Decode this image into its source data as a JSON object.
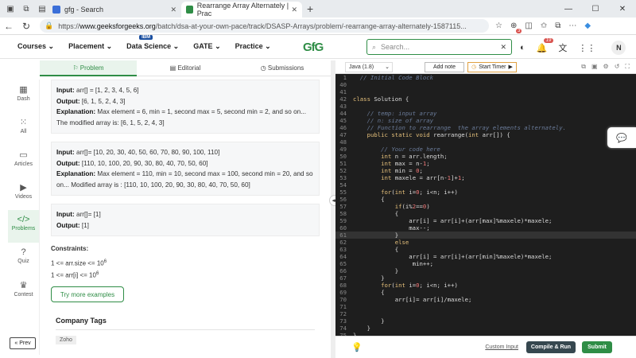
{
  "browser": {
    "tabs": [
      {
        "title": "gfg - Search"
      },
      {
        "title": "Rearrange Array Alternately | Prac"
      }
    ],
    "url_prefix": "https://",
    "url_host": "www.geeksforgeeks.org",
    "url_path": "/batch/dsa-at-your-own-pace/track/DSASP-Arrays/problem/-rearrange-array-alternately-1587115...",
    "ext_badge": "3"
  },
  "header": {
    "nav": [
      "Courses",
      "Placement",
      "Data Science",
      "GATE",
      "Practice"
    ],
    "ibm_badge": "IBM",
    "logo": "GfG",
    "search_placeholder": "Search...",
    "notif_count": "19",
    "avatar": "N"
  },
  "sidebar": {
    "items": [
      {
        "label": "Dash",
        "icon": "dashboard-icon"
      },
      {
        "label": "All",
        "icon": "grid-icon"
      },
      {
        "label": "Articles",
        "icon": "article-icon"
      },
      {
        "label": "Videos",
        "icon": "video-icon"
      },
      {
        "label": "Problems",
        "icon": "code-icon"
      },
      {
        "label": "Quiz",
        "icon": "quiz-icon"
      },
      {
        "label": "Contest",
        "icon": "contest-icon"
      }
    ],
    "prev": "« Prev"
  },
  "problem_tabs": [
    "Problem",
    "Editorial",
    "Submissions"
  ],
  "examples": [
    {
      "input": "arr[] = [1, 2, 3, 4, 5, 6]",
      "output": "[6, 1, 5, 2, 4, 3]",
      "explanation": "Max element = 6, min = 1, second max = 5, second min = 2, and so on... The modified array is: [6, 1, 5, 2, 4, 3]"
    },
    {
      "input": "arr[]= [10, 20, 30, 40, 50, 60, 70, 80, 90, 100, 110]",
      "output": "[110, 10, 100, 20, 90, 30, 80, 40, 70, 50, 60]",
      "explanation": "Max element = 110, min = 10, second max = 100, second min = 20, and so on... Modified array is : [110, 10, 100, 20, 90, 30, 80, 40, 70, 50, 60]"
    },
    {
      "input": "arr[]= [1]",
      "output": "[1]",
      "explanation": ""
    }
  ],
  "labels": {
    "input": "Input:",
    "output": "Output:",
    "explanation": "Explanation:"
  },
  "constraints": {
    "title": "Constraints:",
    "lines": [
      {
        "text": "1 <= arr.size <= 10",
        "sup": "6"
      },
      {
        "text": "1 <= arr[i] <= 10",
        "sup": "6"
      }
    ]
  },
  "try_more": "Try more examples",
  "company_tags_title": "Company Tags",
  "company_tags": [
    "Zoho"
  ],
  "editor": {
    "language": "Java (1.8)",
    "add_note": "Add note",
    "start_timer": "Start Timer",
    "custom_input": "Custom Input",
    "compile_run": "Compile & Run",
    "submit": "Submit"
  },
  "code_lines": [
    {
      "n": "1",
      "t": "  // Initial Code Block"
    },
    {
      "n": "40",
      "t": ""
    },
    {
      "n": "41",
      "t": ""
    },
    {
      "n": "42",
      "t": "class Solution {"
    },
    {
      "n": "43",
      "t": ""
    },
    {
      "n": "44",
      "t": "    // temp: input array"
    },
    {
      "n": "45",
      "t": "    // n: size of array"
    },
    {
      "n": "46",
      "t": "    // Function to rearrange  the array elements alternately."
    },
    {
      "n": "47",
      "t": "    public static void rearrange(int arr[]) {"
    },
    {
      "n": "48",
      "t": ""
    },
    {
      "n": "49",
      "t": "        // Your code here"
    },
    {
      "n": "50",
      "t": "        int n = arr.length;"
    },
    {
      "n": "51",
      "t": "        int max = n-1;"
    },
    {
      "n": "52",
      "t": "        int min = 0;"
    },
    {
      "n": "53",
      "t": "        int maxele = arr[n-1]+1;"
    },
    {
      "n": "54",
      "t": ""
    },
    {
      "n": "55",
      "t": "        for(int i=0; i<n; i++)"
    },
    {
      "n": "56",
      "t": "        {"
    },
    {
      "n": "57",
      "t": "            if(i%2==0)"
    },
    {
      "n": "58",
      "t": "            {"
    },
    {
      "n": "59",
      "t": "                arr[i] = arr[i]+(arr[max]%maxele)*maxele;"
    },
    {
      "n": "60",
      "t": "                max--;"
    },
    {
      "n": "61",
      "t": "            }"
    },
    {
      "n": "62",
      "t": "            else"
    },
    {
      "n": "63",
      "t": "            {"
    },
    {
      "n": "64",
      "t": "                arr[i] = arr[i]+(arr[min]%maxele)*maxele;"
    },
    {
      "n": "65",
      "t": "                 min++;"
    },
    {
      "n": "66",
      "t": "            }"
    },
    {
      "n": "67",
      "t": "        }"
    },
    {
      "n": "68",
      "t": "        for(int i=0; i<n; i++)"
    },
    {
      "n": "69",
      "t": "        {"
    },
    {
      "n": "70",
      "t": "            arr[i]= arr[i]/maxele;"
    },
    {
      "n": "71",
      "t": ""
    },
    {
      "n": "72",
      "t": ""
    },
    {
      "n": "73",
      "t": "        }"
    },
    {
      "n": "74",
      "t": "    }"
    },
    {
      "n": "75",
      "t": "}"
    }
  ],
  "colors": {
    "brand": "#2f8d46",
    "editor_bg": "#1e1e1e"
  }
}
